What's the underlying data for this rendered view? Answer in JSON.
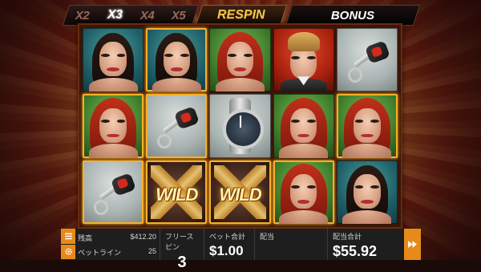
{
  "top_bar": {
    "multipliers": [
      "X2",
      "X3",
      "X4",
      "X5"
    ],
    "active_multiplier": "X3",
    "respin_label": "RESPIN",
    "bonus_label": "BONUS"
  },
  "reels": {
    "rows": [
      [
        {
          "symbol": "dark-haired-woman",
          "bg": "teal",
          "win": false
        },
        {
          "symbol": "dark-haired-woman",
          "bg": "teal",
          "win": true
        },
        {
          "symbol": "red-haired-woman",
          "bg": "green",
          "win": false
        },
        {
          "symbol": "blond-man",
          "bg": "red",
          "win": false
        },
        {
          "symbol": "car-key",
          "bg": "grey",
          "win": false
        }
      ],
      [
        {
          "symbol": "red-haired-woman",
          "bg": "green",
          "win": true
        },
        {
          "symbol": "car-key",
          "bg": "grey",
          "win": true
        },
        {
          "symbol": "watch",
          "bg": "grey",
          "win": false
        },
        {
          "symbol": "red-haired-woman",
          "bg": "green",
          "win": false
        },
        {
          "symbol": "red-haired-woman",
          "bg": "green",
          "win": true
        }
      ],
      [
        {
          "symbol": "car-key",
          "bg": "grey",
          "win": true
        },
        {
          "symbol": "wild",
          "bg": "wild",
          "win": true
        },
        {
          "symbol": "wild",
          "bg": "wild",
          "win": true
        },
        {
          "symbol": "red-haired-woman",
          "bg": "green",
          "win": true
        },
        {
          "symbol": "dark-haired-woman",
          "bg": "teal",
          "win": false
        }
      ]
    ],
    "wild_label": "WILD"
  },
  "bottom_bar": {
    "balance_label": "残高",
    "balance_value": "$412.20",
    "betlines_label": "ベットライン",
    "betlines_value": "25",
    "free_spins_label": "フリースピン",
    "free_spins_value": "3",
    "bet_total_label": "ベット合計",
    "bet_total_value": "$1.00",
    "payout_label": "配当",
    "payout_value": "",
    "payout_total_label": "配当合計",
    "payout_total_value": "$55.92"
  },
  "colors": {
    "accent_orange": "#e68a1a",
    "win_frame": "#f5b12a",
    "respin_gold": "#f2c64a"
  },
  "icons": {
    "menu": "menu-icon",
    "settings": "gear-icon",
    "spin": "fast-forward-icon"
  }
}
